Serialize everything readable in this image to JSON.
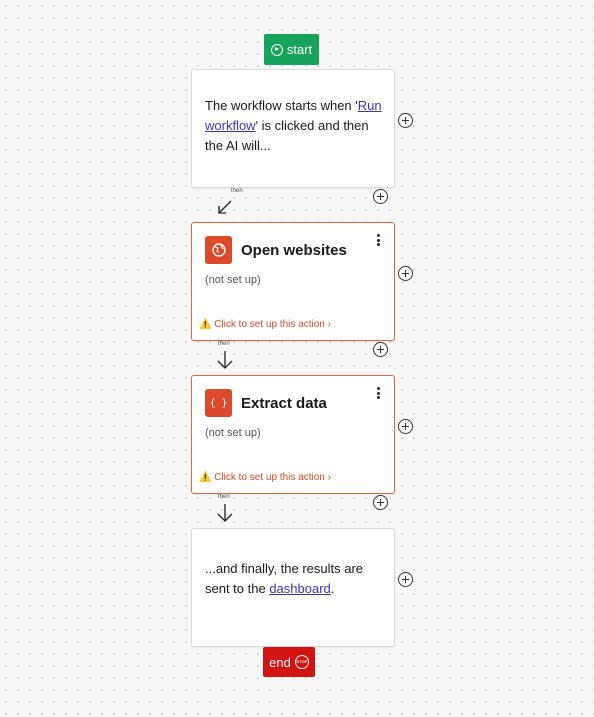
{
  "start": {
    "label": "start"
  },
  "intro": {
    "text_before": "The workflow starts when '",
    "link_text": "Run workflow",
    "text_after": "' is clicked and then the AI will..."
  },
  "connectors": {
    "then_label": "then"
  },
  "actions": [
    {
      "title": "Open websites",
      "status": "(not set up)",
      "setup_prompt": "⚠️ Click to set up this action",
      "setup_chevron": "›",
      "icon": "globe-icon"
    },
    {
      "title": "Extract data",
      "status": "(not set up)",
      "setup_prompt": "⚠️ Click to set up this action",
      "setup_chevron": "›",
      "icon": "curly-braces-icon",
      "icon_glyph": "{ }"
    }
  ],
  "outro": {
    "text_before": "...and finally, the results are sent to the ",
    "link_text": "dashboard",
    "text_after": "."
  },
  "end": {
    "label": "end",
    "stop_text": "STOP"
  },
  "colors": {
    "start": "#17a35b",
    "end": "#d31212",
    "action_accent": "#dc4a2b",
    "link": "#3f30c8"
  }
}
